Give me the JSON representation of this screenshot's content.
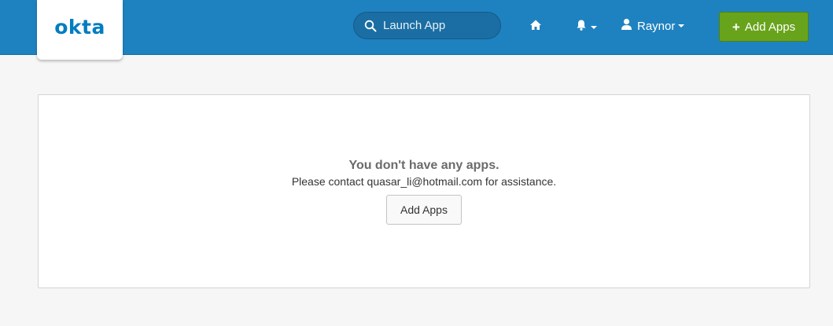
{
  "header": {
    "logo_text": "okta",
    "search": {
      "placeholder": "Launch App",
      "icon": "search-icon"
    },
    "home_icon": "home-icon",
    "notifications_icon": "bell-icon",
    "user": {
      "icon": "user-icon",
      "name": "Raynor"
    },
    "add_apps_button": {
      "icon": "plus-icon",
      "label": "Add Apps"
    },
    "colors": {
      "bar": "#1f82c0",
      "add_button": "#68a31c",
      "logo": "#007dc1"
    }
  },
  "main": {
    "empty_title": "You don't have any apps.",
    "empty_message": "Please contact quasar_li@hotmail.com for assistance.",
    "add_apps_label": "Add Apps"
  }
}
